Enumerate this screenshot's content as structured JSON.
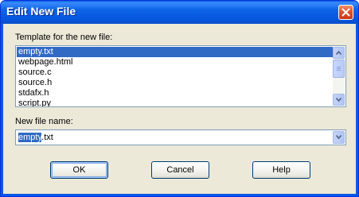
{
  "window": {
    "title": "Edit New File"
  },
  "template_section": {
    "label": "Template for the new file:",
    "items": [
      {
        "label": "empty.txt",
        "selected": true
      },
      {
        "label": "webpage.html",
        "selected": false
      },
      {
        "label": "source.c",
        "selected": false
      },
      {
        "label": "source.h",
        "selected": false
      },
      {
        "label": "stdafx.h",
        "selected": false
      },
      {
        "label": "script.py",
        "selected": false
      }
    ]
  },
  "filename_section": {
    "label": "New file name:",
    "value_selected": "empty",
    "value_rest": ".txt"
  },
  "buttons": {
    "ok": "OK",
    "cancel": "Cancel",
    "help": "Help"
  },
  "colors": {
    "titlebar": "#0a5de6",
    "selection": "#316ac5",
    "dialog_bg": "#ece9d8",
    "close_button": "#e0502a"
  },
  "icons": {
    "close": "close-icon",
    "scroll_up": "chevron-up-icon",
    "scroll_down": "chevron-down-icon",
    "dropdown": "chevron-down-icon"
  }
}
